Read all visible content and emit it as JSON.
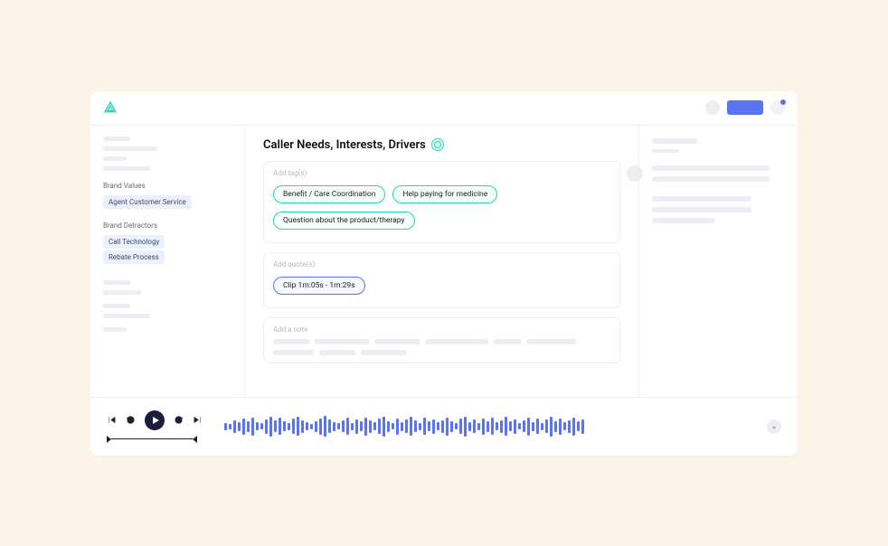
{
  "sidebar": {
    "sections": [
      {
        "title": "Brand Values",
        "chips": [
          "Agent Customer Service"
        ]
      },
      {
        "title": "Brand Detractors",
        "chips": [
          "Call Technology",
          "Rebate Process"
        ]
      }
    ]
  },
  "main": {
    "title": "Caller Needs, Interests, Drivers",
    "tags_label": "Add tag(s)",
    "tags": [
      "Benefit / Care Coordination",
      "Help paying for medicine",
      "Question about the product/therapy"
    ],
    "quotes_label": "Add quote(s)",
    "quotes": [
      "Clip 1m:05s - 1m:29s"
    ],
    "note_label": "Add a note"
  },
  "player": {
    "expand": "⌄"
  }
}
